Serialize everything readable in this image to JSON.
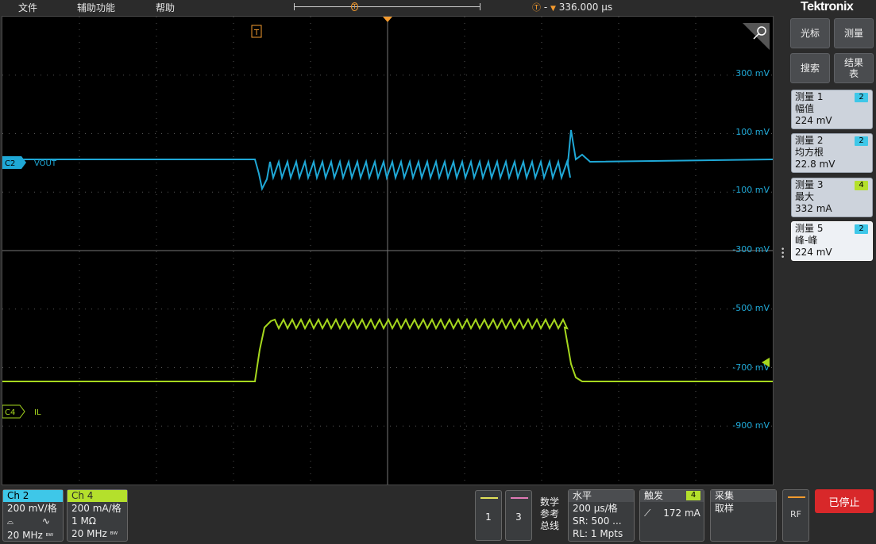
{
  "menu": {
    "file": "文件",
    "utility": "辅助功能",
    "help": "帮助"
  },
  "timeline": {
    "trigger_delay": "336.000 µs",
    "trigger_letter": "T"
  },
  "brand": "Tektronix",
  "side": {
    "cursor_label": "光标",
    "measure_label": "测量",
    "search_label": "搜索",
    "results_label": "结果表"
  },
  "measurements": [
    {
      "title": "测量 1",
      "name": "幅值",
      "value": "224 mV",
      "channel": "2",
      "color": "#3ec7e8"
    },
    {
      "title": "测量 2",
      "name": "均方根",
      "value": "22.8 mV",
      "channel": "2",
      "color": "#3ec7e8"
    },
    {
      "title": "测量 3",
      "name": "最大",
      "value": "332 mA",
      "channel": "4",
      "color": "#b4e02c"
    },
    {
      "title": "测量 5",
      "name": "峰-峰",
      "value": "224 mV",
      "channel": "2",
      "color": "#3ec7e8"
    }
  ],
  "waveform": {
    "ch2_label": "C2",
    "ch2_name": "VOUT",
    "ch2_color": "#1fa8d6",
    "ch4_label": "C4",
    "ch4_name": "IL",
    "ch4_color": "#a6d81e",
    "trigger_marker": "T",
    "scale_labels": [
      "300 mV",
      "100 mV",
      "-100 mV",
      "-300 mV",
      "-500 mV",
      "-700 mV",
      "-900 mV"
    ]
  },
  "channels": [
    {
      "title": "Ch 2",
      "scale": "200 mV/格",
      "bw": "20 MHz",
      "color": "#3ec7e8"
    },
    {
      "title": "Ch 4",
      "scale": "200 mA/格",
      "impedance": "1 MΩ",
      "bw": "20 MHz",
      "color": "#b4e02c"
    }
  ],
  "bottom": {
    "btn1": "1",
    "btn1_color": "#e2e25a",
    "btn3": "3",
    "btn3_color": "#e07ab6",
    "math_label": "数学参考总线",
    "horizontal": {
      "title": "水平",
      "scale": "200 µs/格",
      "sr": "SR: 500 ...",
      "rl": "RL: 1 Mpts"
    },
    "trigger": {
      "title": "触发",
      "channel": "4",
      "level": "172 mA"
    },
    "acquire": {
      "title": "采集",
      "mode": "取样"
    },
    "rf": "RF",
    "stop": "已停止"
  }
}
